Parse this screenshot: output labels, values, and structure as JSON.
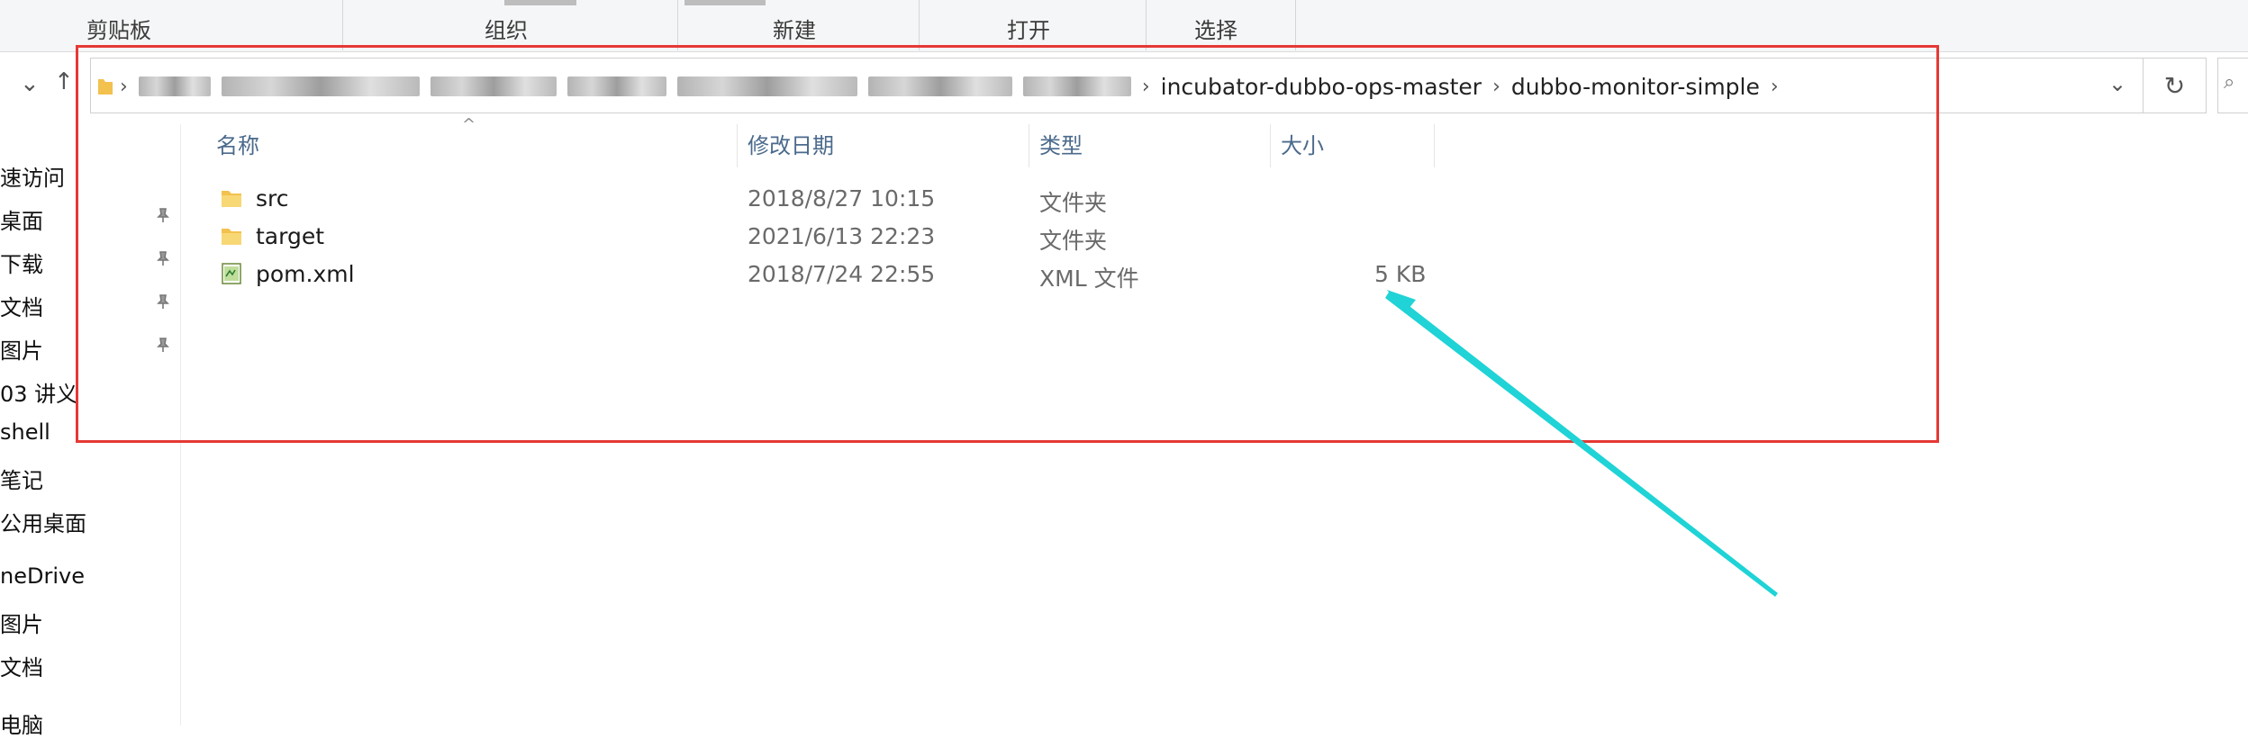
{
  "ribbon": {
    "groups": [
      "剪贴板",
      "组织",
      "新建",
      "打开",
      "选择"
    ]
  },
  "nav": {
    "back_icon": "chevron-down-icon",
    "up_icon": "up-arrow-icon"
  },
  "address": {
    "crumbs": [
      "incubator-dubbo-ops-master",
      "dubbo-monitor-simple"
    ]
  },
  "sidebar": {
    "items": [
      "速访问",
      "桌面",
      "下载",
      "文档",
      "图片",
      "03 讲义",
      "shell",
      "笔记",
      "公用桌面",
      "neDrive",
      "图片",
      "文档",
      "电脑"
    ]
  },
  "columns": {
    "name": "名称",
    "date": "修改日期",
    "type": "类型",
    "size": "大小"
  },
  "files": [
    {
      "name": "src",
      "date": "2018/8/27 10:15",
      "type": "文件夹",
      "size": "",
      "icon": "folder-icon"
    },
    {
      "name": "target",
      "date": "2021/6/13 22:23",
      "type": "文件夹",
      "size": "",
      "icon": "folder-icon"
    },
    {
      "name": "pom.xml",
      "date": "2018/7/24 22:55",
      "type": "XML 文件",
      "size": "5 KB",
      "icon": "xml-file-icon"
    }
  ],
  "colors": {
    "highlight_box": "#e53935",
    "annotation_arrow": "#1fd3d6",
    "folder": "#f2c14e"
  }
}
